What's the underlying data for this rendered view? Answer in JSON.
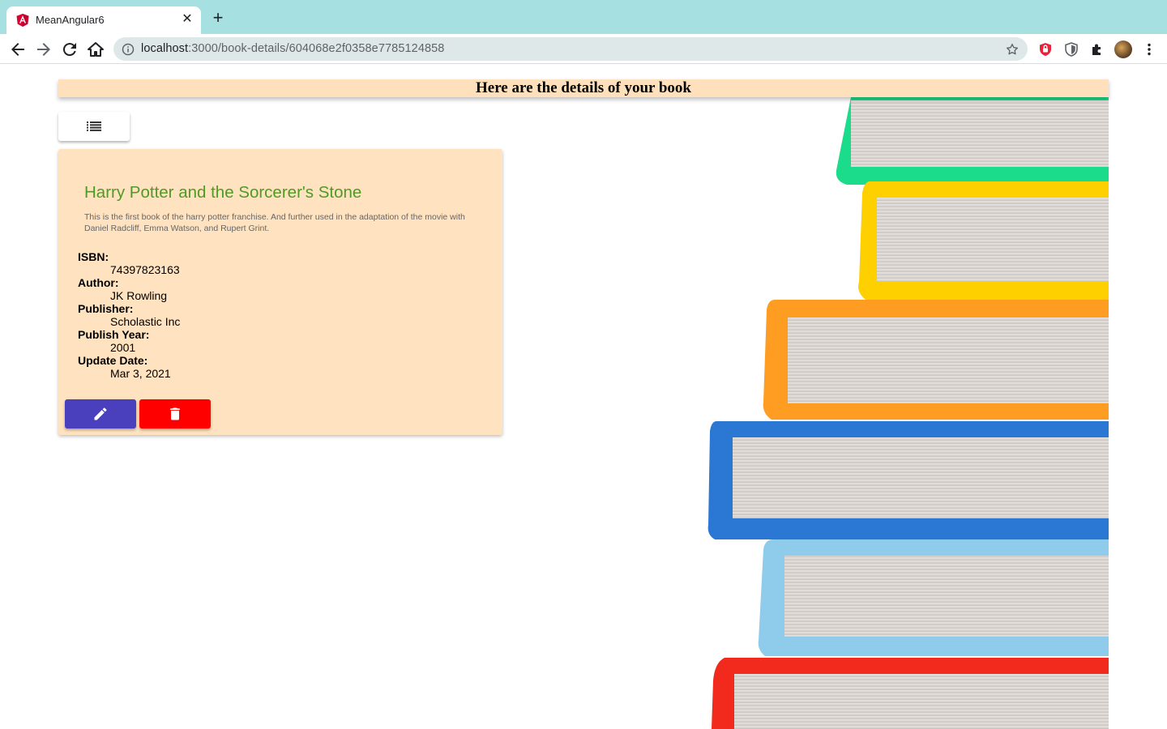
{
  "browser": {
    "tab_title": "MeanAngular6",
    "url_host": "localhost",
    "url_path": ":3000/book-details/604068e2f0358e7785124858"
  },
  "page": {
    "header_title": "Here are the details of your book",
    "book": {
      "title": "Harry Potter and the Sorcerer's Stone",
      "description": "This is the first book of the harry potter franchise. And further used in the adaptation of the movie with Daniel Radcliff, Emma Watson, and Rupert Grint.",
      "fields": [
        {
          "label": "ISBN:",
          "value": "74397823163"
        },
        {
          "label": "Author:",
          "value": "JK Rowling"
        },
        {
          "label": "Publisher:",
          "value": "Scholastic Inc"
        },
        {
          "label": "Publish Year:",
          "value": "2001"
        },
        {
          "label": "Update Date:",
          "value": "Mar 3, 2021"
        }
      ]
    }
  },
  "colors": {
    "header_bg": "#ffe0bc",
    "card_bg": "#ffe2bf",
    "title_color": "#4f9a25",
    "edit_button": "#4a3fbd",
    "delete_button": "#ff0000",
    "tabbar_bg": "#a6e0e1"
  },
  "icons": {
    "list_button": "list-icon",
    "edit_button": "edit-icon",
    "delete_button": "trash-icon"
  }
}
